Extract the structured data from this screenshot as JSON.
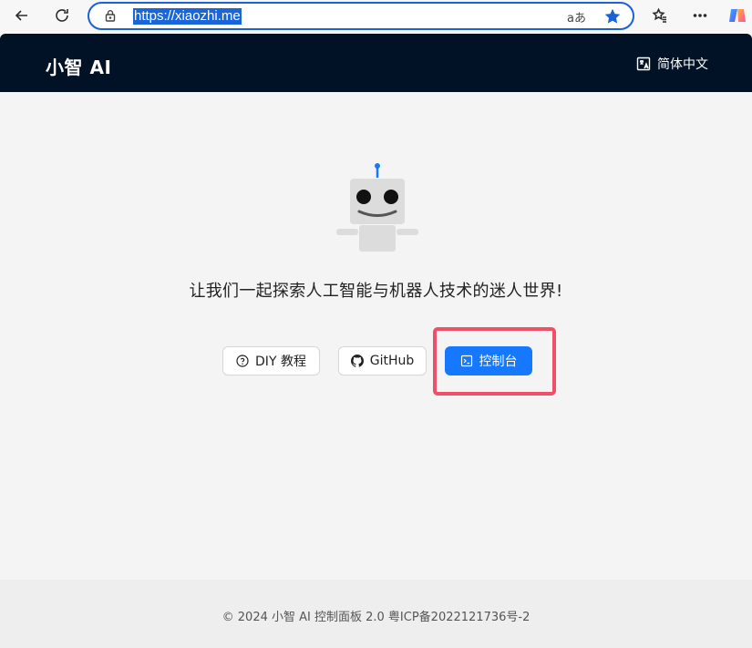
{
  "browser": {
    "url": "https://xiaozhi.me",
    "read_aloud": "aあ"
  },
  "header": {
    "logo": "小智 AI",
    "language": "简体中文"
  },
  "main": {
    "tagline": "让我们一起探索人工智能与机器人技术的迷人世界!",
    "buttons": {
      "diy": "DIY 教程",
      "github": "GitHub",
      "console": "控制台"
    }
  },
  "footer": {
    "text": "© 2024 小智 AI 控制面板 2.0 粤ICP备2022121736号-2"
  },
  "colors": {
    "header_bg": "#011126",
    "primary": "#1677ff",
    "highlight": "#f04f68"
  },
  "icons": [
    "back-arrow-icon",
    "refresh-icon",
    "lock-icon",
    "read-aloud-icon",
    "favorite-star-icon",
    "favorites-icon",
    "more-icon",
    "copilot-icon",
    "language-icon",
    "robot-icon",
    "help-circle-icon",
    "github-icon",
    "terminal-icon"
  ]
}
